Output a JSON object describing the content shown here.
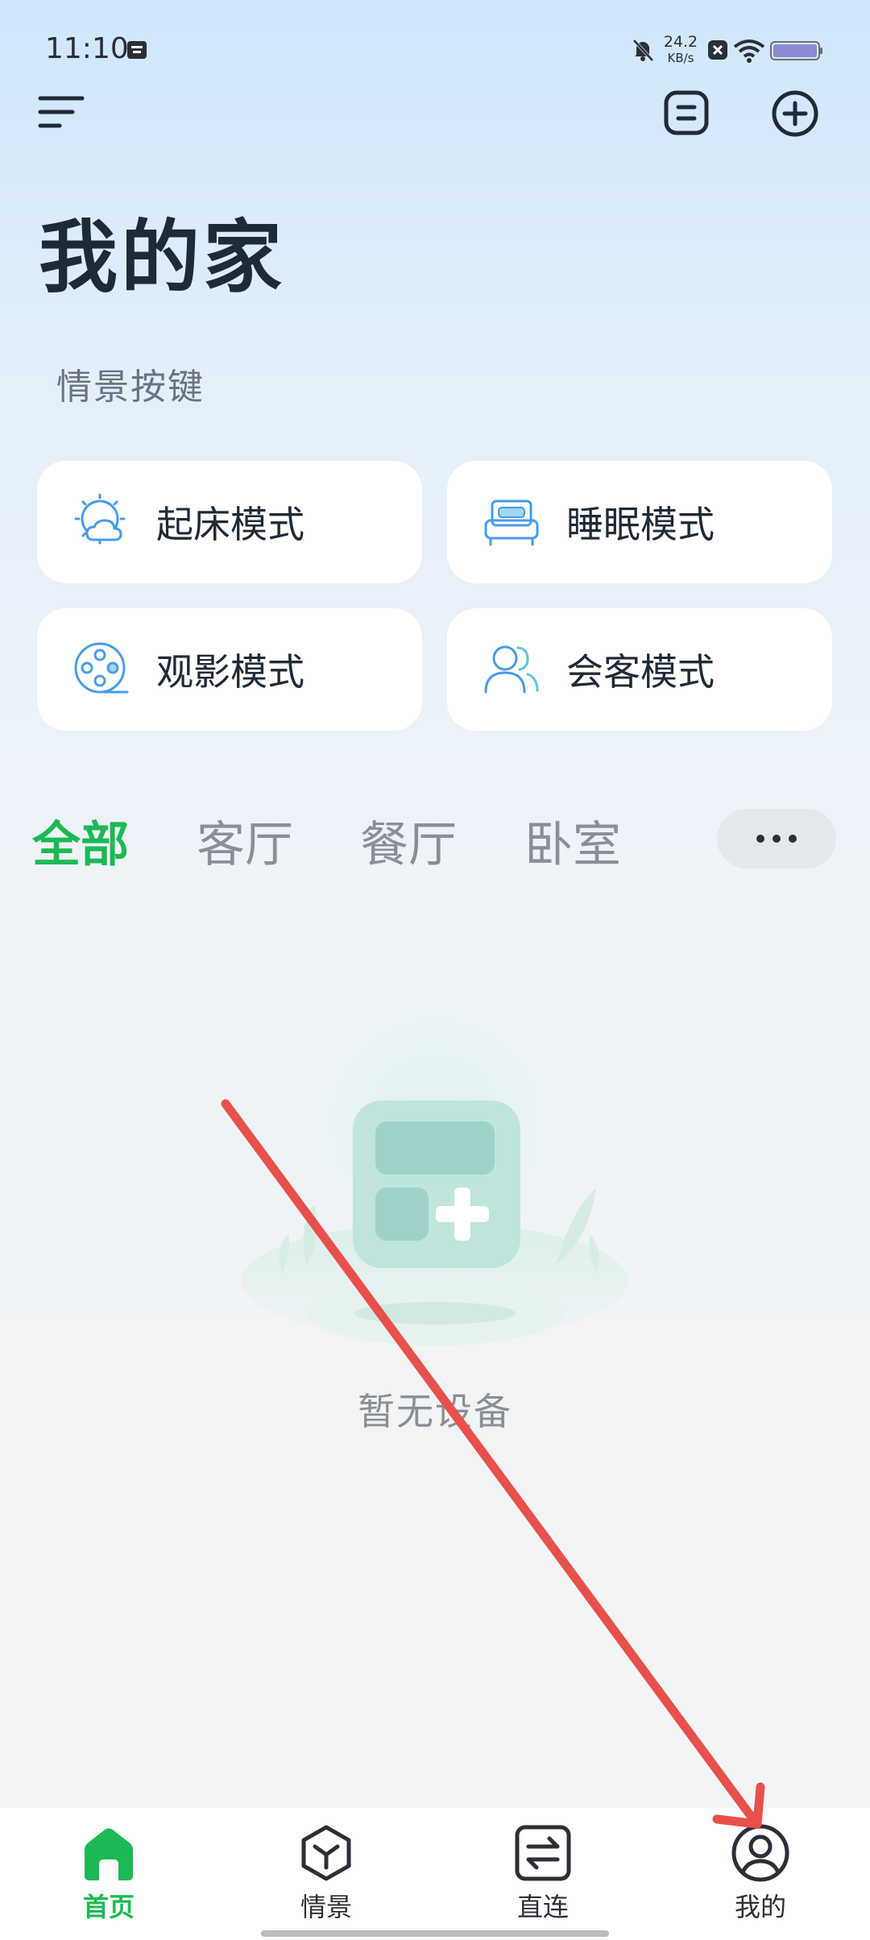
{
  "status_bar": {
    "time": "11:10",
    "net_speed_value": "24.2",
    "net_speed_unit": "KB/s",
    "icons": [
      "app-notification-icon",
      "mute-bell-icon",
      "close-box-icon",
      "wifi-icon",
      "battery-icon"
    ]
  },
  "header": {
    "menu_icon": "hamburger-menu-icon",
    "list_icon": "list-box-icon",
    "add_icon": "add-circle-icon"
  },
  "page_title": "我的家",
  "scenes": {
    "section_title": "情景按键",
    "items": [
      {
        "label": "起床模式",
        "icon": "sun-cloud-icon"
      },
      {
        "label": "睡眠模式",
        "icon": "bed-icon"
      },
      {
        "label": "观影模式",
        "icon": "film-reel-icon"
      },
      {
        "label": "会客模式",
        "icon": "guests-icon"
      }
    ]
  },
  "rooms": {
    "tabs": [
      "全部",
      "客厅",
      "餐厅",
      "卧室"
    ],
    "active": "全部",
    "more_icon": "more-dots-icon"
  },
  "empty_state": {
    "text": "暂无设备",
    "icon": "add-device-illustration"
  },
  "bottom_nav": {
    "items": [
      {
        "label": "首页",
        "icon": "home-icon",
        "active": true
      },
      {
        "label": "情景",
        "icon": "scene-cube-icon"
      },
      {
        "label": "直连",
        "icon": "direct-connect-icon"
      },
      {
        "label": "我的",
        "icon": "profile-icon"
      }
    ]
  },
  "colors": {
    "accent": "#1db954",
    "card_icon": "#4a9be8",
    "annotation": "#e8504b"
  }
}
